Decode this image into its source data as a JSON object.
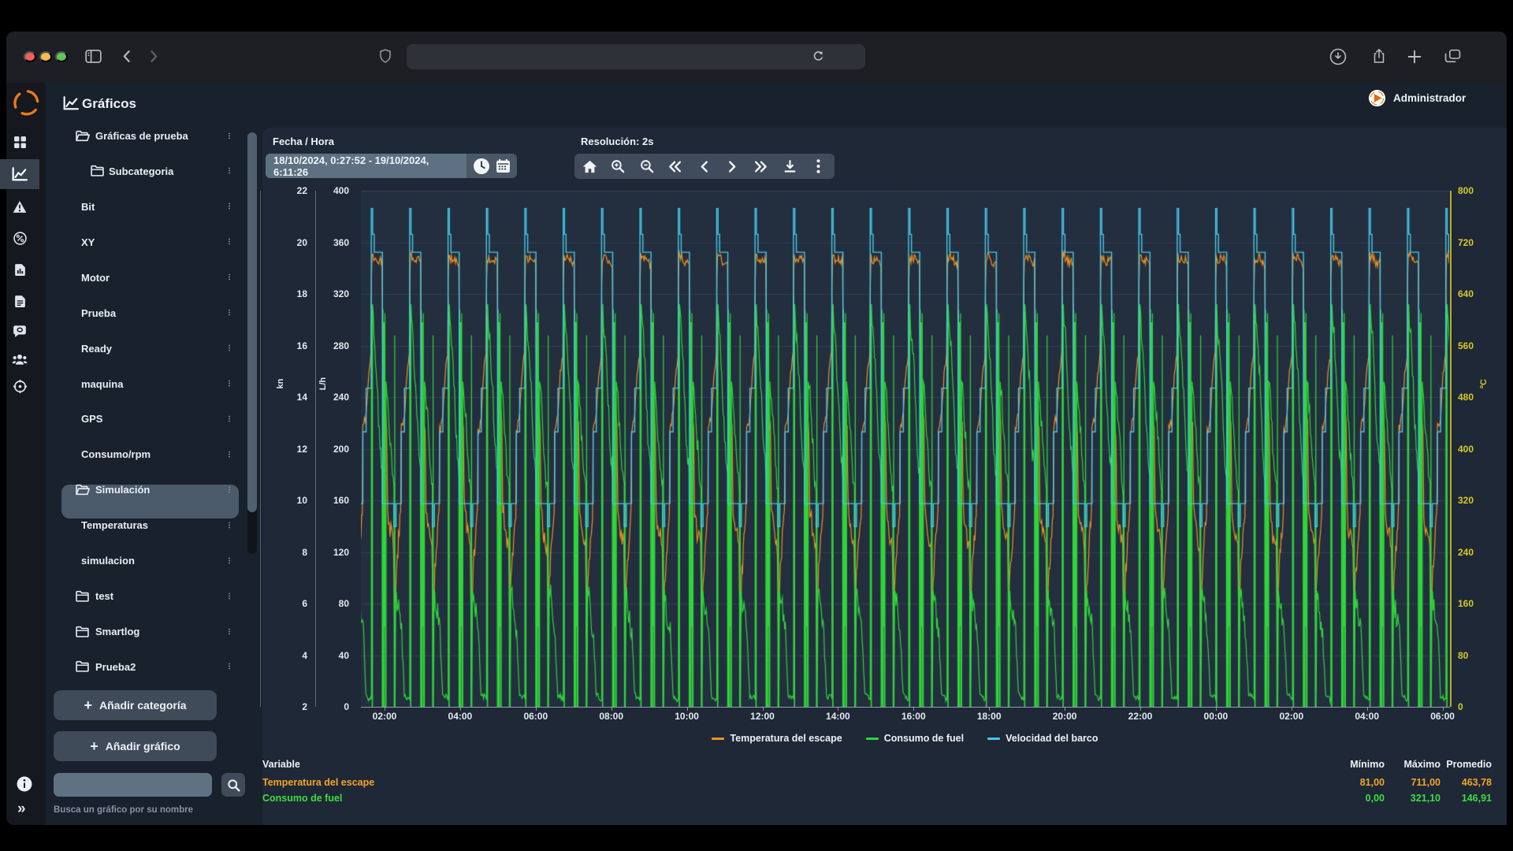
{
  "window": {
    "traffic_colors": [
      "#f0605a",
      "#f5bd4b",
      "#62c554"
    ],
    "url_value": ""
  },
  "rail": {
    "items": [
      {
        "name": "dashboard"
      },
      {
        "name": "charts",
        "selected": true
      },
      {
        "name": "alerts"
      },
      {
        "name": "percent"
      },
      {
        "name": "reports"
      },
      {
        "name": "documents"
      },
      {
        "name": "comments"
      },
      {
        "name": "users"
      },
      {
        "name": "navigation"
      }
    ],
    "bottom": [
      {
        "name": "info"
      },
      {
        "name": "collapse"
      }
    ],
    "collapse_glyph": "»"
  },
  "header": {
    "title": "Gráficos",
    "user": "Administrador"
  },
  "sidebar": {
    "items": [
      {
        "label": "Gráficas de prueba",
        "kind": "category-open"
      },
      {
        "label": "Subcategoria",
        "kind": "subcategory"
      },
      {
        "label": "Bit",
        "kind": "chart"
      },
      {
        "label": "XY",
        "kind": "chart"
      },
      {
        "label": "Motor",
        "kind": "chart"
      },
      {
        "label": "Prueba",
        "kind": "chart"
      },
      {
        "label": "Ready",
        "kind": "chart"
      },
      {
        "label": "maquina",
        "kind": "chart"
      },
      {
        "label": "GPS",
        "kind": "chart"
      },
      {
        "label": "Consumo/rpm",
        "kind": "chart"
      },
      {
        "label": "Simulación",
        "kind": "category-open",
        "selected": true
      },
      {
        "label": "Temperaturas",
        "kind": "chart"
      },
      {
        "label": "simulacion",
        "kind": "chart"
      },
      {
        "label": "test",
        "kind": "category-closed"
      },
      {
        "label": "Smartlog",
        "kind": "category-closed"
      },
      {
        "label": "Prueba2",
        "kind": "category-closed"
      }
    ],
    "add_category": "Añadir categoría",
    "add_chart": "Añadir gráfico",
    "search_value": "",
    "search_caption": "Busca un gráfico por su nombre"
  },
  "toolbar": {
    "date_label": "Fecha / Hora",
    "date_value": "18/10/2024, 0:27:52 - 19/10/2024, 6:11:26",
    "resolution": "Resolución: 2s",
    "buttons": [
      {
        "name": "home"
      },
      {
        "name": "zoom-in"
      },
      {
        "name": "zoom-out"
      },
      {
        "name": "seek-start"
      },
      {
        "name": "step-back"
      },
      {
        "name": "step-forward"
      },
      {
        "name": "seek-end"
      },
      {
        "name": "download"
      },
      {
        "name": "more"
      }
    ]
  },
  "chart_data": {
    "type": "line",
    "x_range": [
      "18/10/2024 0:27:52",
      "19/10/2024 6:11:26"
    ],
    "resolution": "2s",
    "grid": "horizontal",
    "legend_position": "bottom",
    "x_ticks": [
      "02:00",
      "04:00",
      "06:00",
      "08:00",
      "10:00",
      "12:00",
      "14:00",
      "16:00",
      "18:00",
      "20:00",
      "22:00",
      "00:00",
      "02:00",
      "04:00",
      "06:00"
    ],
    "axes": {
      "kn": {
        "unit": "kn",
        "min": 2,
        "max": 22,
        "ticks": [
          22,
          20,
          18,
          16,
          14,
          12,
          10,
          8,
          6,
          4,
          2
        ],
        "side": "left",
        "color": "#e3eaf1"
      },
      "lh": {
        "unit": "L/h",
        "min": 0,
        "max": 400,
        "ticks": [
          400,
          360,
          320,
          280,
          240,
          200,
          160,
          120,
          80,
          40,
          0
        ],
        "side": "left",
        "color": "#e3eaf1"
      },
      "degC": {
        "unit": "ºC",
        "min": 0,
        "max": 800,
        "ticks": [
          800,
          720,
          640,
          560,
          480,
          400,
          320,
          240,
          160,
          80,
          0
        ],
        "side": "right",
        "color": "#d5ca24"
      }
    },
    "cycles_visible": 29,
    "cycle_period_hours": 1,
    "series": [
      {
        "name": "Temperatura del escape",
        "axis": "degC",
        "color": "#f0921f",
        "min": 81.0,
        "max": 711.0,
        "avg": 463.78,
        "cycle": [
          [
            0,
            545,
            8
          ],
          [
            0.015,
            660,
            10
          ],
          [
            0.03,
            698,
            10
          ],
          [
            0.29,
            688,
            10
          ],
          [
            0.305,
            560,
            18
          ],
          [
            0.33,
            488,
            22
          ],
          [
            0.41,
            432,
            14
          ],
          [
            0.435,
            305,
            18
          ],
          [
            0.5,
            272,
            22
          ],
          [
            0.59,
            250,
            18
          ],
          [
            0.615,
            125,
            28
          ],
          [
            0.65,
            195,
            22
          ],
          [
            0.72,
            258,
            18
          ],
          [
            0.775,
            300,
            12
          ],
          [
            0.79,
            428,
            12
          ],
          [
            0.875,
            452,
            10
          ],
          [
            0.935,
            515,
            8
          ],
          [
            1,
            545,
            8
          ]
        ]
      },
      {
        "name": "Consumo de fuel",
        "axis": "lh",
        "color": "#2ed539",
        "min": 0.0,
        "max": 321.1,
        "avg": 146.91,
        "cycle": [
          [
            0,
            6,
            3
          ],
          [
            0.012,
            6,
            0
          ],
          [
            0.012,
            318,
            0
          ],
          [
            0.022,
            295,
            8
          ],
          [
            0.032,
            0,
            0
          ],
          [
            0.042,
            0,
            0
          ],
          [
            0.042,
            312,
            0
          ],
          [
            0.06,
            298,
            10
          ],
          [
            0.1,
            285,
            10
          ],
          [
            0.16,
            252,
            13
          ],
          [
            0.235,
            200,
            11
          ],
          [
            0.29,
            182,
            8
          ],
          [
            0.295,
            0,
            0
          ],
          [
            0.315,
            0,
            0
          ],
          [
            0.315,
            308,
            0
          ],
          [
            0.325,
            0,
            0
          ],
          [
            0.34,
            0,
            0
          ],
          [
            0.34,
            298,
            0
          ],
          [
            0.35,
            62,
            0
          ],
          [
            0.365,
            305,
            0
          ],
          [
            0.375,
            0,
            0
          ],
          [
            0.395,
            0,
            0
          ],
          [
            0.395,
            252,
            0
          ],
          [
            0.44,
            238,
            13
          ],
          [
            0.5,
            208,
            13
          ],
          [
            0.56,
            178,
            10
          ],
          [
            0.6,
            170,
            7
          ],
          [
            0.607,
            0,
            0
          ],
          [
            0.62,
            0,
            0
          ],
          [
            0.62,
            288,
            0
          ],
          [
            0.63,
            0,
            0
          ],
          [
            0.648,
            90,
            0
          ],
          [
            0.68,
            82,
            14
          ],
          [
            0.74,
            70,
            12
          ],
          [
            0.8,
            58,
            10
          ],
          [
            0.84,
            30,
            7
          ],
          [
            0.87,
            9,
            3
          ],
          [
            1,
            6,
            3
          ]
        ]
      },
      {
        "name": "Velocidad del barco",
        "axis": "kn",
        "color": "#46c9ea",
        "cycle": [
          [
            0,
            14.3,
            0
          ],
          [
            0.01,
            14.3,
            0
          ],
          [
            0.01,
            21.3,
            0
          ],
          [
            0.045,
            21.3,
            0
          ],
          [
            0.045,
            20.3,
            0
          ],
          [
            0.085,
            20.3,
            0
          ],
          [
            0.085,
            19.6,
            0
          ],
          [
            0.3,
            19.6,
            0
          ],
          [
            0.3,
            9.8,
            0
          ],
          [
            0.6,
            9.8,
            0
          ],
          [
            0.6,
            8.9,
            0
          ],
          [
            0.655,
            8.9,
            0
          ],
          [
            0.655,
            9.8,
            0
          ],
          [
            0.79,
            9.8,
            0
          ],
          [
            0.79,
            12.6,
            0
          ],
          [
            0.875,
            12.6,
            0
          ],
          [
            0.875,
            14.3,
            0
          ],
          [
            1,
            14.3,
            0
          ]
        ]
      }
    ]
  },
  "stats": {
    "headers": [
      "Variable",
      "Mínimo",
      "Máximo",
      "Promedio"
    ],
    "rows": [
      {
        "name": "Temperatura del escape",
        "color": "#f5a427",
        "min": "81,00",
        "max": "711,00",
        "avg": "463,78"
      },
      {
        "name": "Consumo de fuel",
        "color": "#3fdc41",
        "min": "0,00",
        "max": "321,10",
        "avg": "146,91"
      }
    ]
  }
}
